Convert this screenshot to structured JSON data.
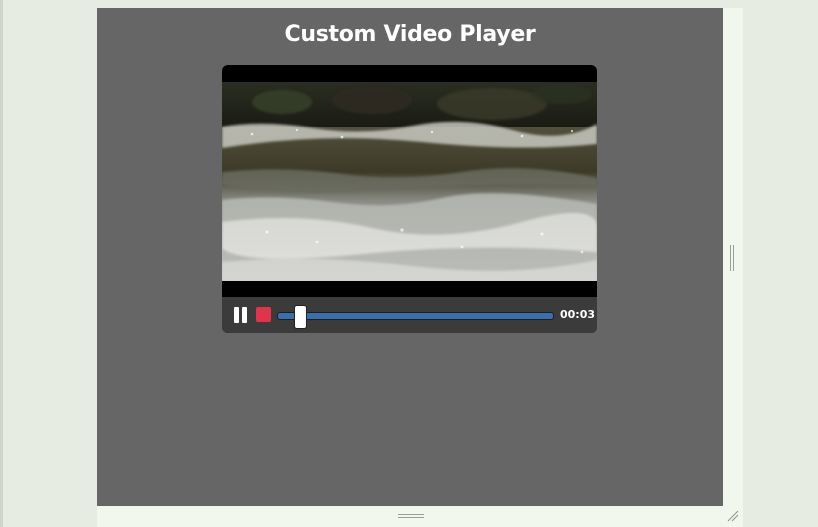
{
  "page": {
    "title": "Custom Video Player"
  },
  "player": {
    "current_time": "00:03",
    "progress_fraction": 0.06,
    "state": "playing",
    "icons": {
      "pause": "pause-icon",
      "stop": "stop-icon"
    },
    "colors": {
      "stop_button": "#e0344a",
      "progress_fill": "#3a6fae",
      "controls_bg": "#3b3b3b",
      "stage_bg": "#666666"
    }
  }
}
